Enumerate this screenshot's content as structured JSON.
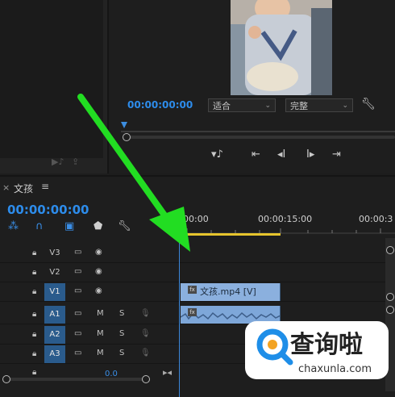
{
  "source_panel": {
    "icons": [
      "insert-icon",
      "export-frame-icon"
    ]
  },
  "program": {
    "timecode": "00:00:00:00",
    "zoom_select": "适合",
    "quality_select": "完整",
    "transport": [
      "add-marker-icon",
      "go-to-in-icon",
      "step-back-icon",
      "play-icon",
      "go-to-out-icon"
    ]
  },
  "timeline": {
    "sequence_name": "文孩",
    "timecode": "00:00:00:00",
    "ruler_labels": [
      "00:00",
      "00:00:15:00",
      "00:00:3"
    ],
    "tracks": [
      {
        "name": "V3",
        "type": "video",
        "targeted": false
      },
      {
        "name": "V2",
        "type": "video",
        "targeted": false
      },
      {
        "name": "V1",
        "type": "video",
        "targeted": true
      },
      {
        "name": "A1",
        "type": "audio",
        "targeted": true
      },
      {
        "name": "A2",
        "type": "audio",
        "targeted": true
      },
      {
        "name": "A3",
        "type": "audio",
        "targeted": true
      }
    ],
    "audio_buttons": {
      "mute": "M",
      "solo": "S"
    },
    "video_clip": {
      "label": "文孩.mp4 [V]",
      "fx": "fx"
    },
    "audio_clip": {
      "fx": "fx"
    },
    "master_value": "0.0"
  },
  "watermark": {
    "text": "查询啦",
    "url": "chaxunla.com"
  },
  "colors": {
    "accent": "#2d8ceb",
    "clip": "#8bb0de",
    "workarea": "#e7c52d",
    "arrow": "#22dd22"
  }
}
